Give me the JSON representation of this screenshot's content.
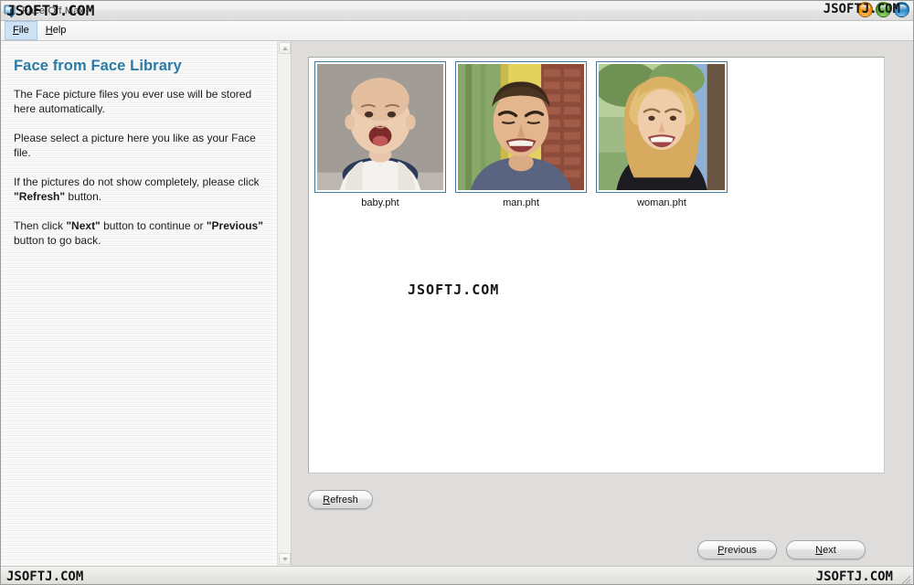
{
  "window": {
    "title": "Face Off Max",
    "icon": "app-download-icon",
    "controls": {
      "minimize": "minimize-button",
      "maximize": "maximize-button",
      "close": "close-button"
    }
  },
  "watermarks": {
    "title_left": "JSOFTJ.COM",
    "title_right": "JSOFTJ.COM",
    "center": "JSOFTJ.COM",
    "status_left": "JSOFTJ.COM",
    "status_right": "JSOFTJ.COM"
  },
  "menu": {
    "items": [
      {
        "label": "File",
        "mnemonic": "F",
        "rest": "ile",
        "active": true
      },
      {
        "label": "Help",
        "mnemonic": "H",
        "rest": "elp",
        "active": false
      }
    ]
  },
  "sidebar": {
    "title": "Face from Face Library",
    "paragraphs": [
      {
        "segments": [
          {
            "text": "The Face picture files you ever use will be stored here automatically.",
            "bold": false
          }
        ]
      },
      {
        "segments": [
          {
            "text": "Please select a picture here you like as your Face file.",
            "bold": false
          }
        ]
      },
      {
        "segments": [
          {
            "text": "If the pictures do not show completely, please click ",
            "bold": false
          },
          {
            "text": "\"Refresh\"",
            "bold": true
          },
          {
            "text": " button.",
            "bold": false
          }
        ]
      },
      {
        "segments": [
          {
            "text": "Then click ",
            "bold": false
          },
          {
            "text": "\"Next\"",
            "bold": true
          },
          {
            "text": " button to continue or ",
            "bold": false
          },
          {
            "text": "\"Previous\"",
            "bold": true
          },
          {
            "text": " button to go back.",
            "bold": false
          }
        ]
      }
    ],
    "scrollbar": {
      "up_arrow": "scroll-up-arrow",
      "down_arrow": "scroll-down-arrow"
    }
  },
  "gallery": {
    "items": [
      {
        "label": "baby.pht",
        "subject": "baby",
        "selected": false
      },
      {
        "label": "man.pht",
        "subject": "man",
        "selected": false
      },
      {
        "label": "woman.pht",
        "subject": "woman",
        "selected": false
      }
    ],
    "border_color": "#3f7ca3"
  },
  "buttons": {
    "refresh": {
      "label": "Refresh",
      "mnemonic": "R",
      "rest": "efresh"
    },
    "previous": {
      "label": "Previous",
      "mnemonic": "P",
      "rest": "revious"
    },
    "next": {
      "label": "Next",
      "mnemonic": "N",
      "rest": "ext"
    }
  },
  "colors": {
    "accent": "#2a7ba6",
    "thumb_border": "#3f7ca3",
    "window_bg": "#dedddb",
    "panel_bg": "#ffffff",
    "menu_active_bg": "#cde3f5"
  }
}
